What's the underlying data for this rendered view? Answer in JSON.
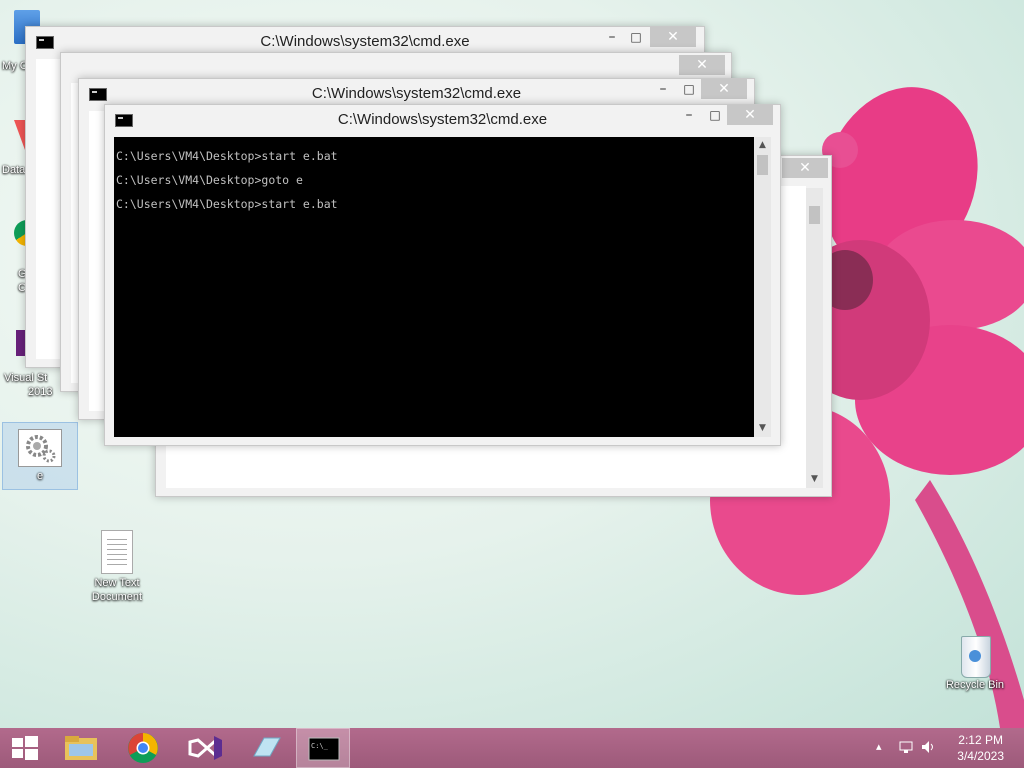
{
  "desktop": {
    "icons": {
      "my_computer_partial": "My C",
      "data_partial": "Data",
      "chrome_partial_1": "G",
      "chrome_partial_2": "C",
      "visual_studio": [
        "Visual St",
        "2013"
      ],
      "e_file": "e",
      "new_text_document": [
        "New Text",
        "Document"
      ],
      "recycle_bin": "Recycle Bin"
    }
  },
  "windows": {
    "back": {
      "title": "C:\\Windows\\system32\\cmd.exe"
    },
    "middle": {
      "title": "C:\\Windows\\system32\\cmd.exe"
    },
    "front": {
      "title": "C:\\Windows\\system32\\cmd.exe",
      "console_lines": [
        "C:\\Users\\VM4\\Desktop>start e.bat",
        "C:\\Users\\VM4\\Desktop>goto e",
        "C:\\Users\\VM4\\Desktop>start e.bat"
      ]
    }
  },
  "window_controls": {
    "minimize": "–",
    "maximize": "□",
    "close": "✕"
  },
  "scroll_arrows": {
    "up": "▲",
    "down": "▼"
  },
  "taskbar": {
    "clock": {
      "time": "2:12 PM",
      "date": "3/4/2023"
    },
    "tray": {
      "chevron": "▴"
    },
    "accent": "#a8617f"
  }
}
